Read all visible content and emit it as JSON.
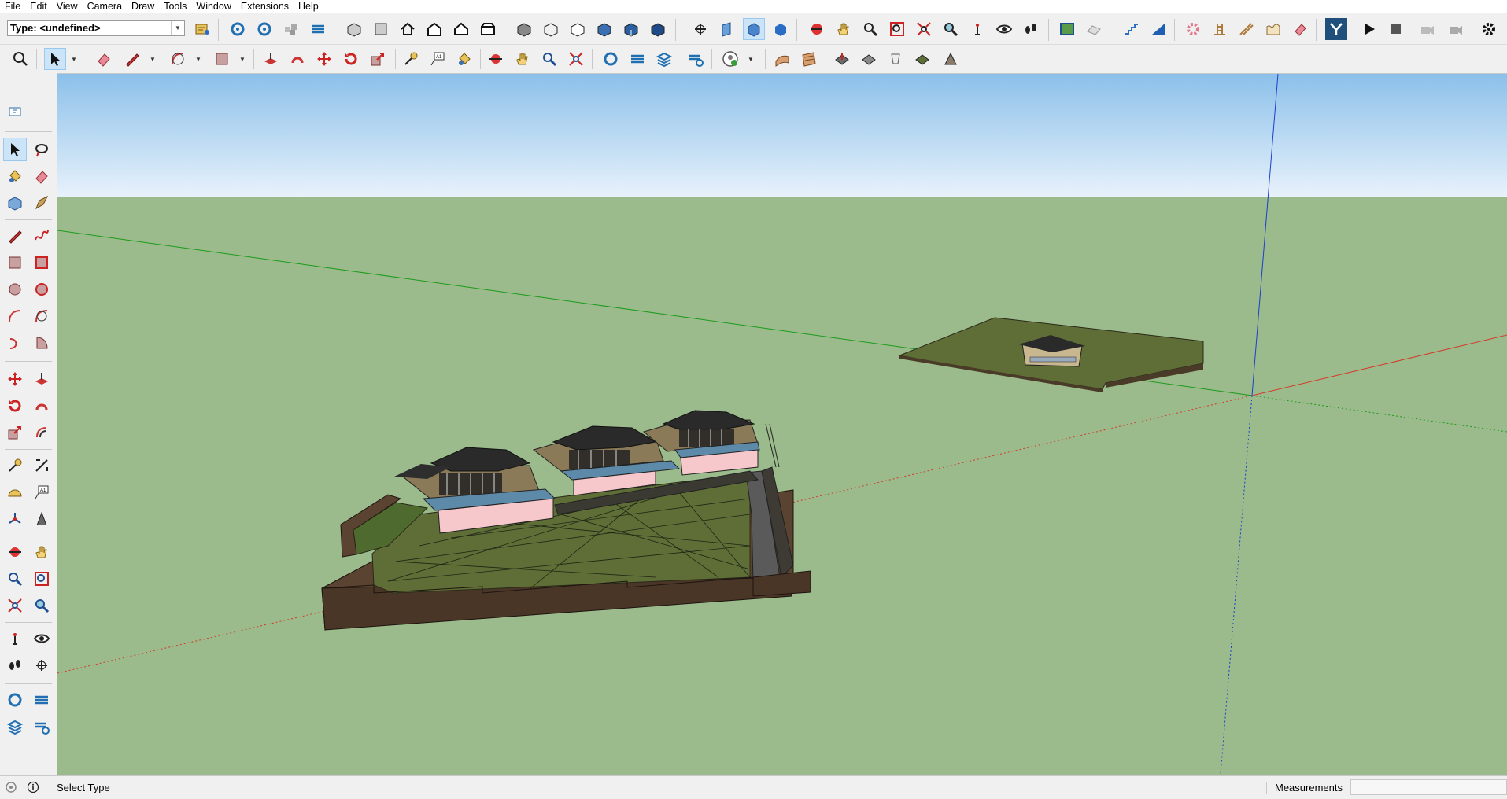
{
  "menu": [
    "File",
    "Edit",
    "View",
    "Camera",
    "Draw",
    "Tools",
    "Window",
    "Extensions",
    "Help"
  ],
  "type_combo": {
    "value": "Type: <undefined>"
  },
  "status": {
    "text": "Select Type"
  },
  "measurements": {
    "label": "Measurements",
    "value": ""
  },
  "colors": {
    "sky_top": "#8cc0ea",
    "sky_bottom": "#e8f2fb",
    "ground": "#9bbb8c",
    "axis_red": "#d43a2a",
    "axis_green": "#1a9b1a",
    "axis_blue": "#1a3fd0",
    "terrain": "#5e6e36",
    "wall": "#5a4330",
    "pool": "#f6c8cc"
  }
}
